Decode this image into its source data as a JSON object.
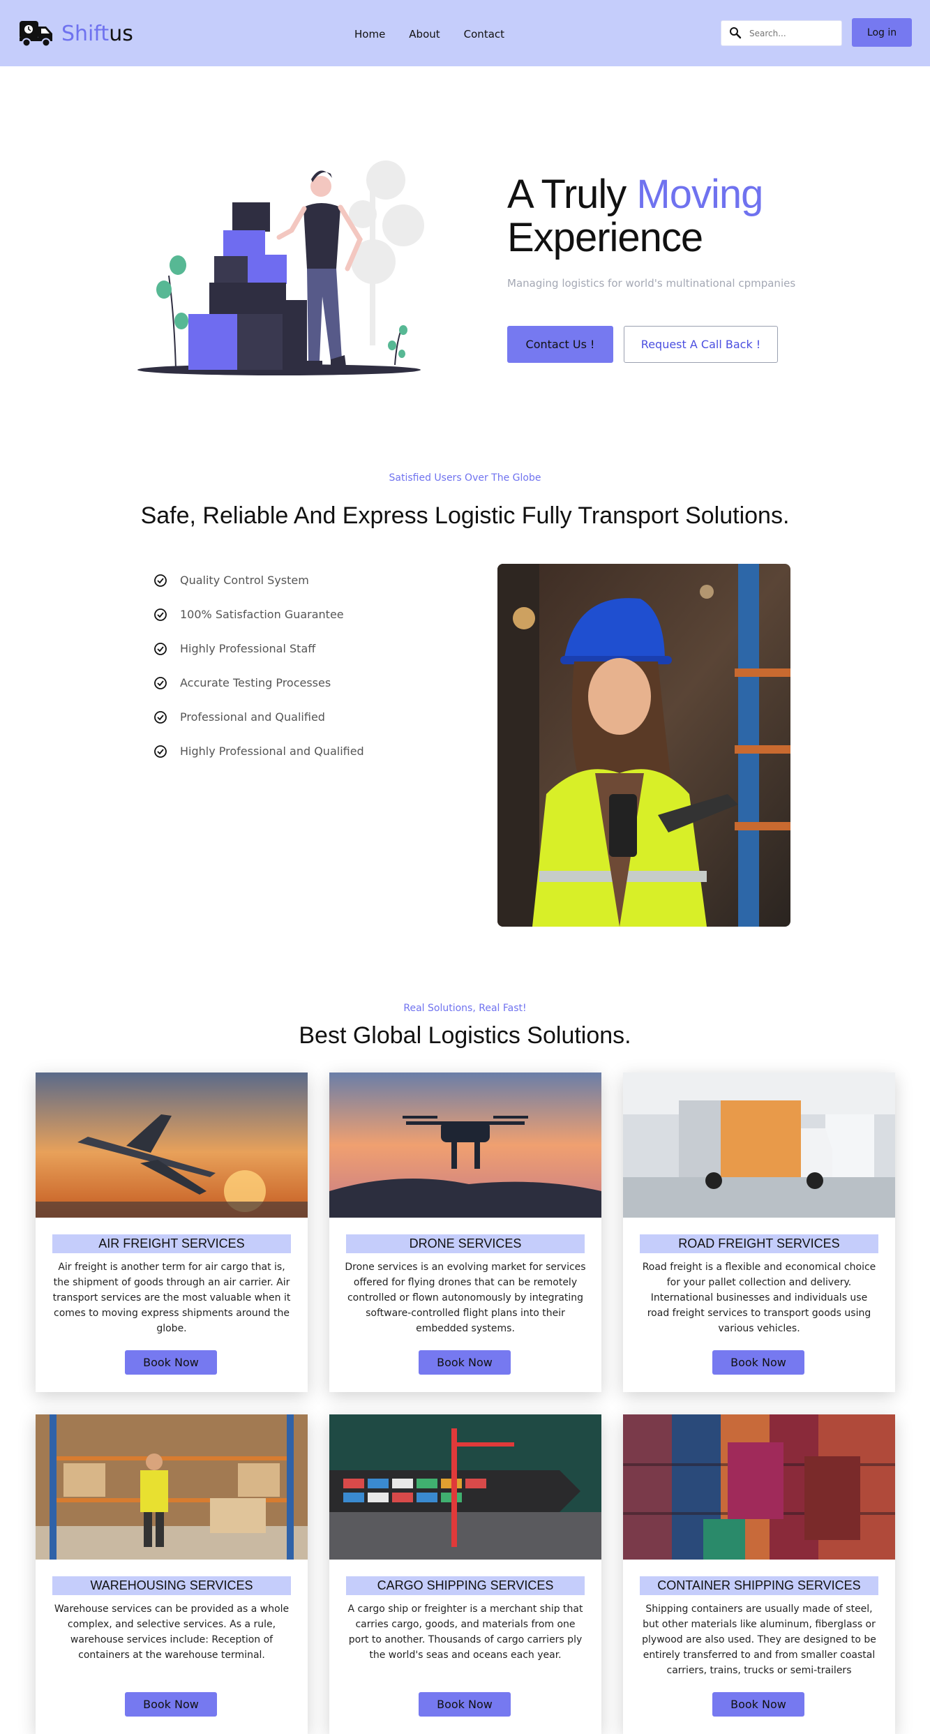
{
  "navbar": {
    "brand_part1": "Shift",
    "brand_part2": "us",
    "links": [
      "Home",
      "About",
      "Contact"
    ],
    "search_placeholder": "Search...",
    "login_label": "Log in"
  },
  "hero": {
    "title_line1_plain": "A Truly ",
    "title_line1_accent": "Moving",
    "title_line2": "Experience",
    "subtitle": "Managing logistics for world's multinational cpmpanies",
    "contact_label": "Contact Us !",
    "callback_label": "Request A Call Back !"
  },
  "features": {
    "kicker": "Satisfied Users Over The Globe",
    "heading": "Safe, Reliable And Express Logistic Fully Transport Solutions.",
    "items": [
      "Quality Control System",
      "100% Satisfaction Guarantee",
      "Highly Professional Staff",
      "Accurate Testing Processes",
      "Professional and Qualified",
      "Highly Professional and Qualified"
    ]
  },
  "services": {
    "kicker": "Real Solutions, Real Fast!",
    "heading": "Best Global Logistics Solutions.",
    "cards": [
      {
        "title": "AIR FREIGHT SERVICES",
        "desc": "Air freight is another term for air cargo that is, the shipment of goods through an air carrier. Air transport services are the most valuable when it comes to moving express shipments around the globe.",
        "button": "Book Now"
      },
      {
        "title": "DRONE SERVICES",
        "desc": "Drone services is an evolving market for services offered for flying drones that can be remotely controlled or flown autonomously by integrating software-controlled flight plans into their embedded systems.",
        "button": "Book Now"
      },
      {
        "title": "ROAD FREIGHT SERVICES",
        "desc": "Road freight is a flexible and economical choice for your pallet collection and delivery. International businesses and individuals use road freight services to transport goods using various vehicles.",
        "button": "Book Now"
      },
      {
        "title": "WAREHOUSING SERVICES",
        "desc": "Warehouse services can be provided as a whole complex, and selective services. As a rule, warehouse services include: Reception of containers at the warehouse terminal.",
        "button": "Book Now"
      },
      {
        "title": "CARGO SHIPPING SERVICES",
        "desc": "A cargo ship or freighter is a merchant ship that carries cargo, goods, and materials from one port to another. Thousands of cargo carriers ply the world's seas and oceans each year.",
        "button": "Book Now"
      },
      {
        "title": "CONTAINER SHIPPING SERVICES",
        "desc": "Shipping containers are usually made of steel, but other materials like aluminum, fiberglass or plywood are also used. They are designed to be entirely transferred to and from smaller coastal carriers, trains, trucks or semi-trailers",
        "button": "Book Now"
      }
    ]
  },
  "colors": {
    "navbar_bg": "#c5cdfb",
    "accent": "#6f72ef",
    "button": "#7679f0",
    "card_title_bg": "#c5cdfb"
  },
  "icons": {
    "brand": "truck-icon",
    "search": "search-icon",
    "feature_bullet": "check-circle-icon"
  }
}
